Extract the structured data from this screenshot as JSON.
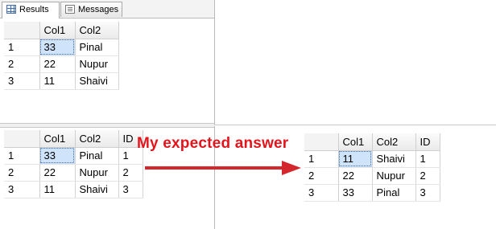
{
  "tabs": [
    {
      "label": "Results",
      "icon": "results-grid-icon",
      "active": true
    },
    {
      "label": "Messages",
      "icon": "messages-icon",
      "active": false
    }
  ],
  "grid1": {
    "columns": [
      "Col1",
      "Col2"
    ],
    "rows": [
      {
        "num": "1",
        "cells": [
          "33",
          "Pinal"
        ]
      },
      {
        "num": "2",
        "cells": [
          "22",
          "Nupur"
        ]
      },
      {
        "num": "3",
        "cells": [
          "11",
          "Shaivi"
        ]
      }
    ]
  },
  "grid2": {
    "columns": [
      "Col1",
      "Col2",
      "ID"
    ],
    "rows": [
      {
        "num": "1",
        "cells": [
          "33",
          "Pinal",
          "1"
        ]
      },
      {
        "num": "2",
        "cells": [
          "22",
          "Nupur",
          "2"
        ]
      },
      {
        "num": "3",
        "cells": [
          "11",
          "Shaivi",
          "3"
        ]
      }
    ]
  },
  "expected_grid": {
    "columns": [
      "Col1",
      "Col2",
      "ID"
    ],
    "rows": [
      {
        "num": "1",
        "cells": [
          "11",
          "Shaivi",
          "1"
        ]
      },
      {
        "num": "2",
        "cells": [
          "22",
          "Nupur",
          "2"
        ]
      },
      {
        "num": "3",
        "cells": [
          "33",
          "Pinal",
          "3"
        ]
      }
    ]
  },
  "annotation": {
    "text": "My expected answer",
    "color": "#e4141c"
  },
  "colors": {
    "selected_cell": "#cfe3fa",
    "header_bg": "#eaeaea",
    "arrow": "#d4262d"
  }
}
